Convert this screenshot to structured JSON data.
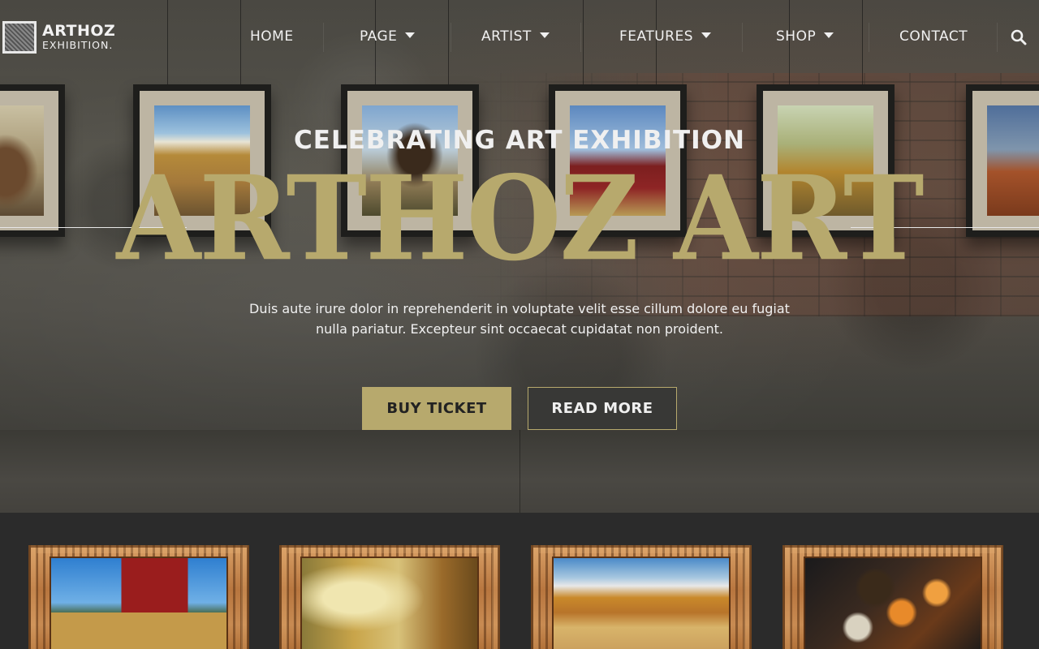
{
  "brand": {
    "name": "ARTHOZ",
    "tagline": "EXHIBITION."
  },
  "nav": {
    "items": [
      {
        "label": "HOME",
        "has_dropdown": false
      },
      {
        "label": "PAGE",
        "has_dropdown": true
      },
      {
        "label": "ARTIST",
        "has_dropdown": true
      },
      {
        "label": "FEATURES",
        "has_dropdown": true
      },
      {
        "label": "SHOP",
        "has_dropdown": true
      },
      {
        "label": "CONTACT",
        "has_dropdown": false
      }
    ],
    "search_icon": "search-icon"
  },
  "hero": {
    "eyebrow": "CELEBRATING ART EXHIBITION",
    "title": "ARTHOZ ART",
    "description": "Duis aute irure dolor in reprehenderit in voluptate velit esse cillum dolore eu fugiat nulla pariatur. Excepteur sint occaecat cupidatat non proident.",
    "primary_button": "BUY TICKET",
    "secondary_button": "READ MORE"
  },
  "colors": {
    "accent": "#b7a96d",
    "dark_background": "#2b2b2b",
    "text_light": "#f0f0f0"
  },
  "wall_paintings": [
    {
      "subject": "deer"
    },
    {
      "subject": "country road landscape"
    },
    {
      "subject": "horse rider"
    },
    {
      "subject": "red barn"
    },
    {
      "subject": "autumn trees"
    },
    {
      "subject": "canyon"
    }
  ],
  "gallery": [
    {
      "subject": "red barn"
    },
    {
      "subject": "autumn forest"
    },
    {
      "subject": "country road landscape"
    },
    {
      "subject": "abstract orange spheres"
    }
  ]
}
